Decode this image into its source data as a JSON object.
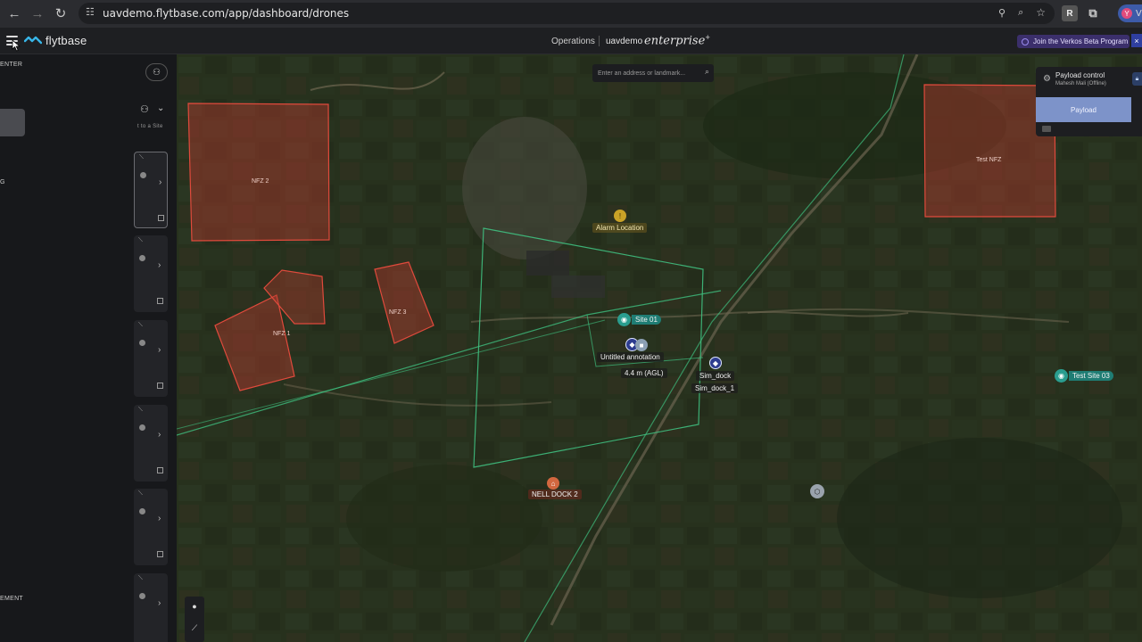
{
  "browser": {
    "url": "uavdemo.flytbase.com/app/dashboard/drones",
    "extension_label": "R",
    "profile_initial": "Y",
    "profile_label": "V"
  },
  "header": {
    "logo_text": "flytbase",
    "nav_operations": "Operations",
    "org_name": "uavdemo",
    "org_tier": "enterprise",
    "tier_mark": "+",
    "beta_banner": "Join the Verkos Beta Program",
    "beta_close": "×"
  },
  "sidebar": {
    "section_top": "ENTER",
    "site_hint": "t to a Site",
    "group_label": "G",
    "section_bottom": "EMENT"
  },
  "map": {
    "search_placeholder": "Enter an address or landmark...",
    "nfz": [
      "NFZ 2",
      "NFZ 1",
      "NFZ 3",
      "Test NFZ"
    ],
    "alarm_label": "Alarm Location",
    "site_label": "Site 01",
    "annotation_label": "Untitled annotation",
    "altitude_label": "4.4 m (AGL)",
    "sim_dock_label": "Sim_dock",
    "sim_dock_1_label": "Sim_dock_1",
    "test_site_label": "Test Site 03",
    "dock_label": "NELL DOCK 2"
  },
  "payload": {
    "title": "Payload control",
    "subtitle": "Mahesh Mali (Offline)",
    "button_label": "Payload"
  },
  "colors": {
    "nfz_fill": "#b33a2e",
    "nfz_stroke": "#e04a3c",
    "geofence": "#3fbf7f",
    "teal": "#1f7d74",
    "accent_beta": "#3b2f6b",
    "payload_button": "#7d93c9"
  }
}
